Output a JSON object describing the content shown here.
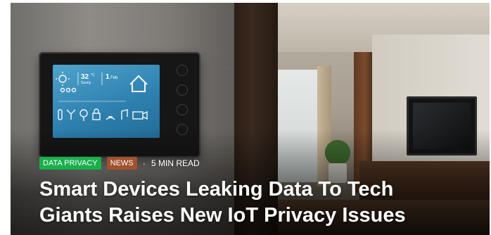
{
  "article": {
    "categories": [
      {
        "label": "DATA PRIVACY",
        "color": "#19b04b"
      },
      {
        "label": "NEWS",
        "color": "#a0522d"
      }
    ],
    "separator": "·",
    "read_time": "5 MIN READ",
    "title": "Smart Devices Leaking Data To Tech Giants Raises New IoT Privacy Issues"
  },
  "thermostat_screen": {
    "temperature": "32",
    "unit": "°C",
    "day": "Sunny",
    "date_day": "1",
    "date_month": "Feb"
  }
}
